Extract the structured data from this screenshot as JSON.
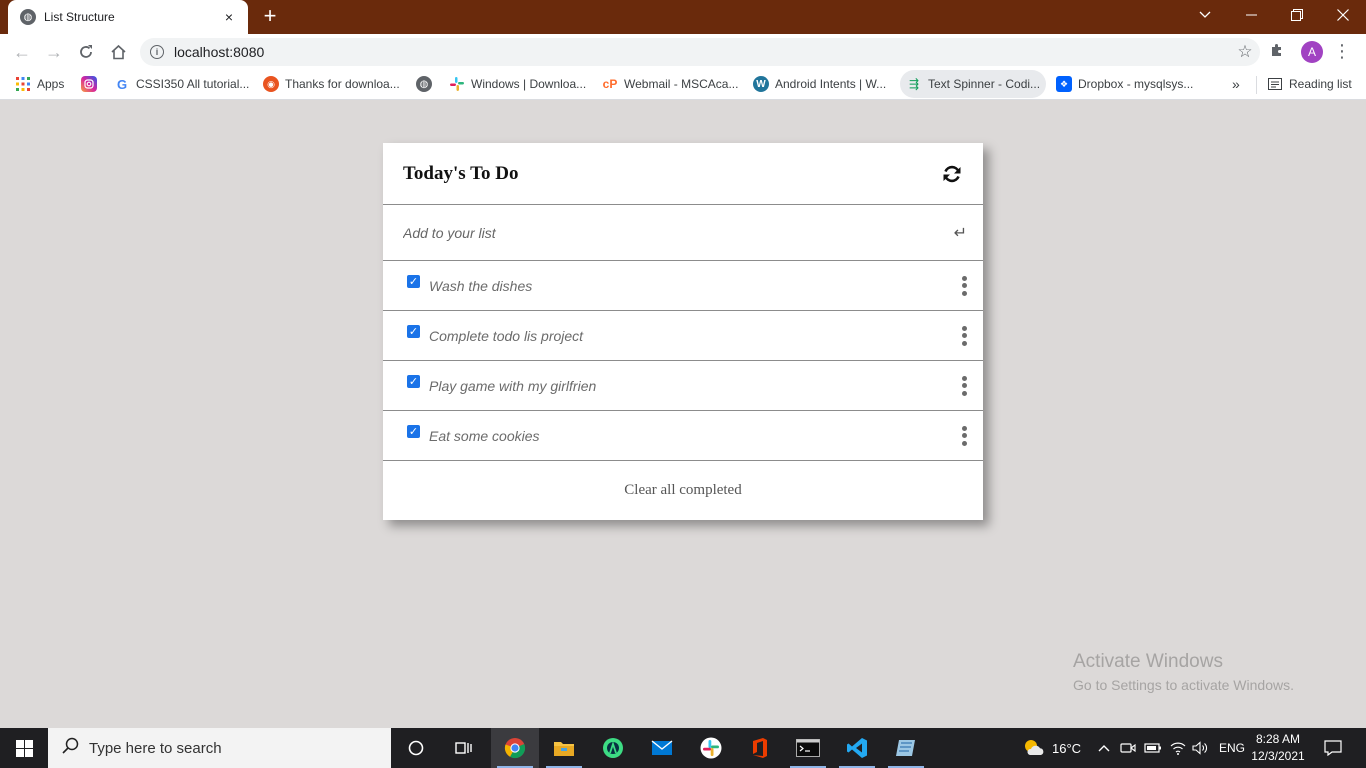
{
  "browser": {
    "tab_title": "List Structure",
    "tab_close": "×",
    "new_tab": "+",
    "url": "localhost:8080",
    "profile_initial": "A",
    "bookmarks": [
      {
        "label": "Apps",
        "icon": "apps-grid-icon"
      },
      {
        "label": "",
        "icon": "instagram-icon"
      },
      {
        "label": "CSSI350 All tutorial...",
        "icon": "google-icon"
      },
      {
        "label": "Thanks for downloa...",
        "icon": "ubuntu-icon"
      },
      {
        "label": "",
        "icon": "globe-icon"
      },
      {
        "label": "Windows | Downloa...",
        "icon": "slack-icon"
      },
      {
        "label": "Webmail - MSCAca...",
        "icon": "cpanel-icon"
      },
      {
        "label": "Android Intents | W...",
        "icon": "wordpress-icon"
      },
      {
        "label": "Text Spinner - Codi...",
        "icon": "sheets-icon"
      },
      {
        "label": "Dropbox - mysqlsys...",
        "icon": "dropbox-icon"
      }
    ],
    "more_bookmarks": "»",
    "reading_list": "Reading list"
  },
  "todo": {
    "title": "Today's To Do",
    "input_placeholder": "Add to your list",
    "items": [
      {
        "text": "Wash the dishes",
        "checked": true
      },
      {
        "text": "Complete todo lis project",
        "checked": true
      },
      {
        "text": "Play game with my girlfrien",
        "checked": true
      },
      {
        "text": "Eat some cookies",
        "checked": true
      }
    ],
    "clear_label": "Clear all completed"
  },
  "watermark": {
    "title": "Activate Windows",
    "subtitle": "Go to Settings to activate Windows."
  },
  "taskbar": {
    "search_placeholder": "Type here to search",
    "weather": "16°C",
    "language": "ENG",
    "time": "8:28 AM",
    "date": "12/3/2021"
  },
  "colors": {
    "titlebar": "#6a2a0c",
    "page_bg": "#dcd9d8",
    "checkbox": "#1a73e8",
    "profile": "#a142c2"
  }
}
